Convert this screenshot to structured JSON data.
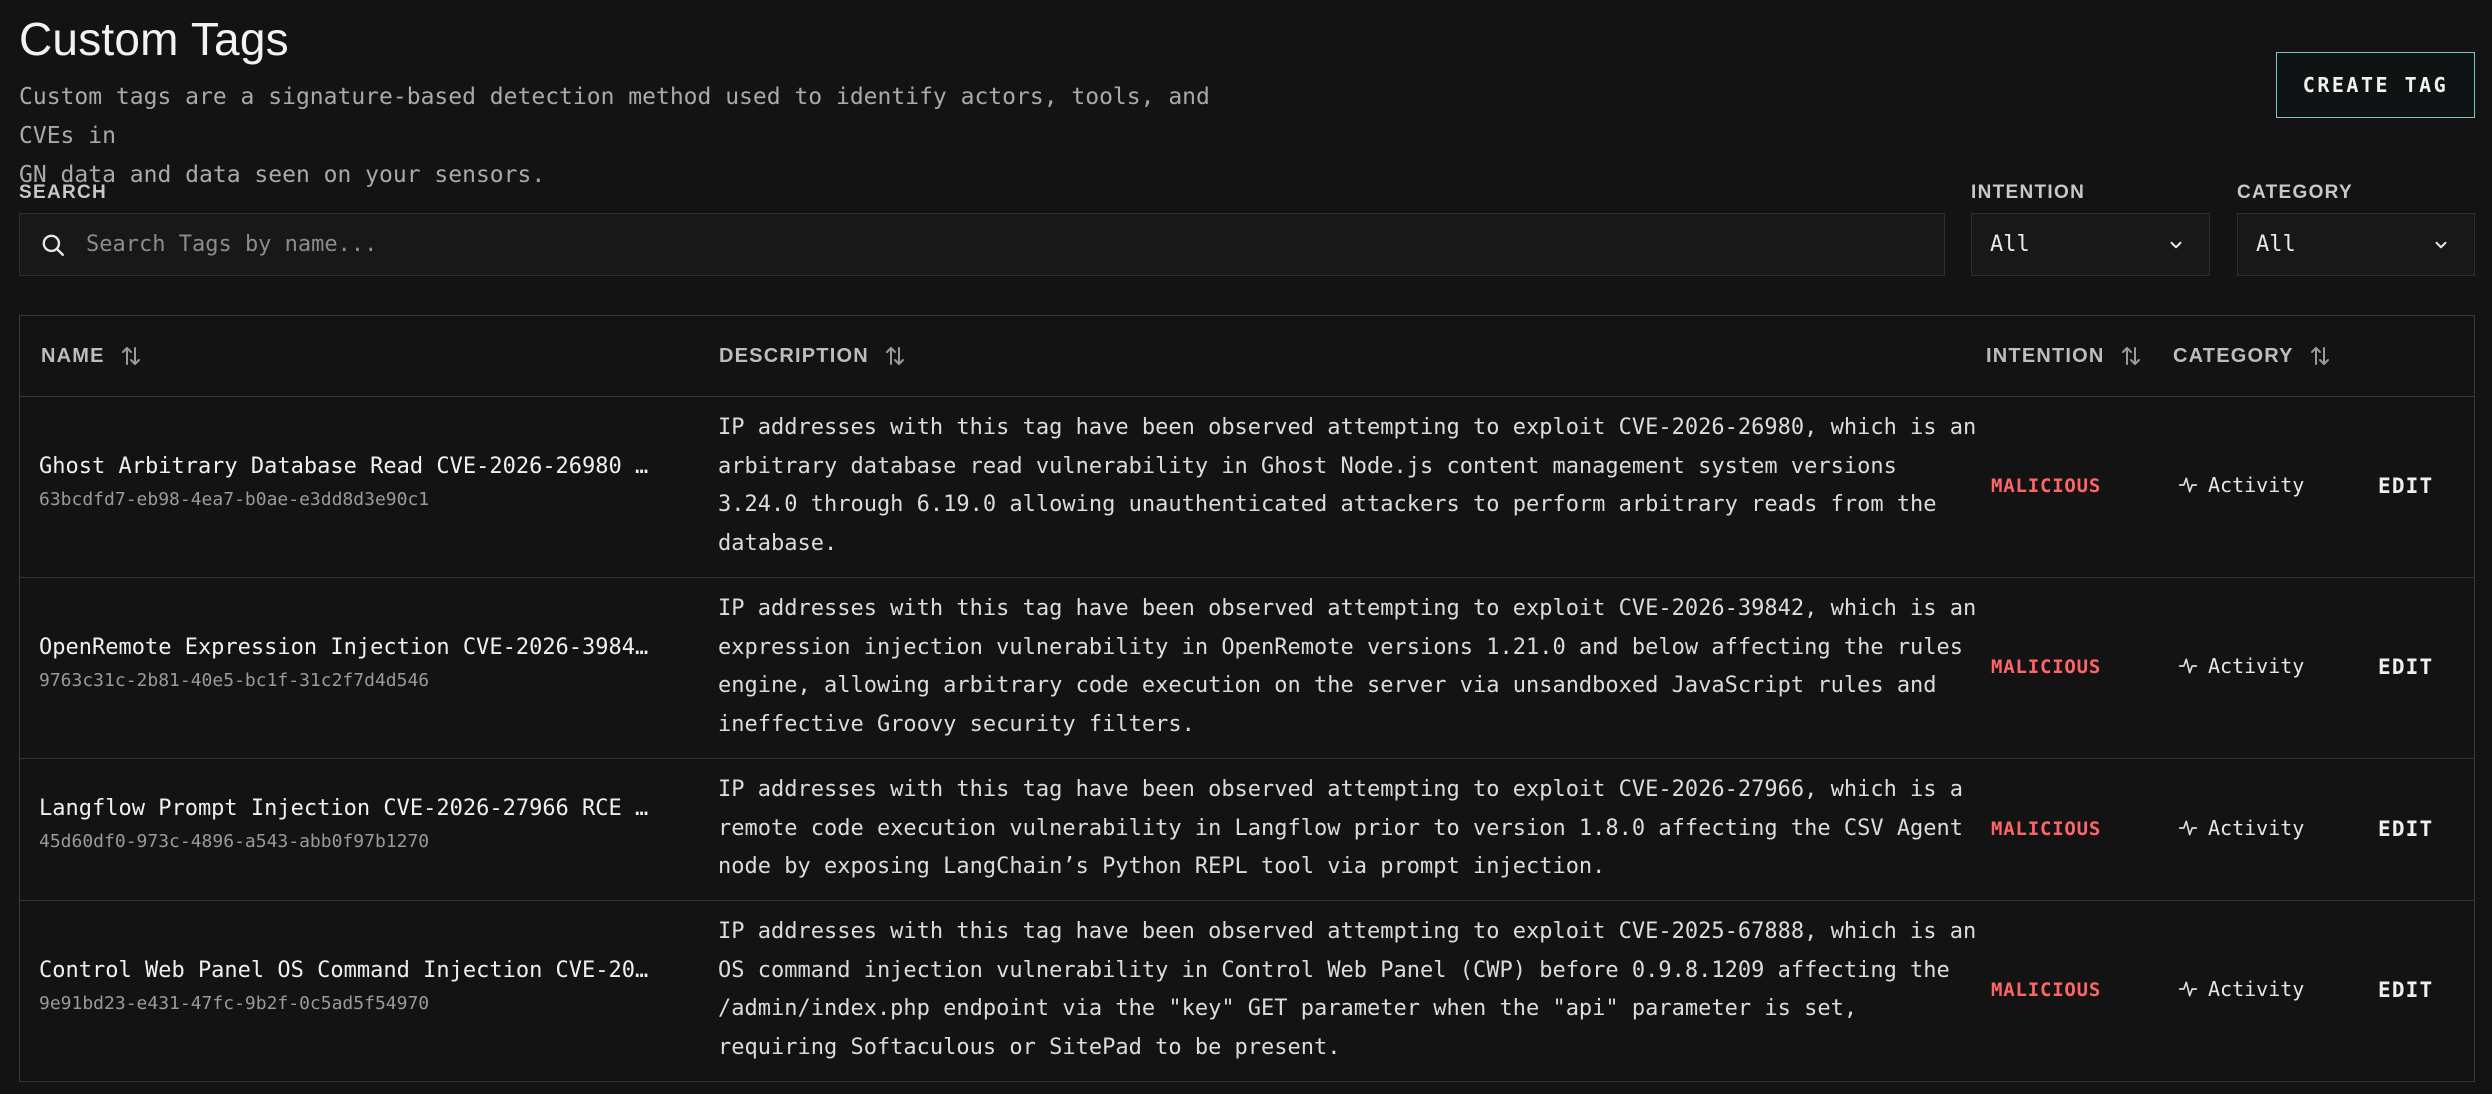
{
  "header": {
    "title": "Custom Tags",
    "subtitle_line1": "Custom tags are a signature-based detection method used to identify actors, tools, and CVEs in",
    "subtitle_line2": "GN data and data seen on your sensors.",
    "create_button": "CREATE TAG"
  },
  "filters": {
    "search_label": "SEARCH",
    "search_placeholder": "Search Tags by name...",
    "intention_label": "INTENTION",
    "intention_value": "All",
    "category_label": "CATEGORY",
    "category_value": "All"
  },
  "table": {
    "columns": {
      "name": "NAME",
      "description": "DESCRIPTION",
      "intention": "INTENTION",
      "category": "CATEGORY"
    },
    "rows": [
      {
        "name": "Ghost Arbitrary Database Read CVE-2026-26980 …",
        "uuid": "63bcdfd7-eb98-4ea7-b0ae-e3dd8d3e90c1",
        "description": [
          "IP addresses with this tag have been observed attempting to exploit CVE-2026-26980, which is an",
          "arbitrary database read vulnerability in Ghost Node.js content management system versions",
          "3.24.0 through 6.19.0 allowing unauthenticated attackers to perform arbitrary reads from the",
          "database."
        ],
        "intention": "MALICIOUS",
        "category": "Activity",
        "action": "EDIT"
      },
      {
        "name": "OpenRemote Expression Injection CVE-2026-3984…",
        "uuid": "9763c31c-2b81-40e5-bc1f-31c2f7d4d546",
        "description": [
          "IP addresses with this tag have been observed attempting to exploit CVE-2026-39842, which is an",
          "expression injection vulnerability in OpenRemote versions 1.21.0 and below affecting the rules",
          "engine, allowing arbitrary code execution on the server via unsandboxed JavaScript rules and",
          "ineffective Groovy security filters."
        ],
        "intention": "MALICIOUS",
        "category": "Activity",
        "action": "EDIT"
      },
      {
        "name": "Langflow Prompt Injection CVE-2026-27966 RCE …",
        "uuid": "45d60df0-973c-4896-a543-abb0f97b1270",
        "description": [
          "IP addresses with this tag have been observed attempting to exploit CVE-2026-27966, which is a",
          "remote code execution vulnerability in Langflow prior to version 1.8.0 affecting the CSV Agent",
          "node by exposing LangChain’s Python REPL tool via prompt injection."
        ],
        "intention": "MALICIOUS",
        "category": "Activity",
        "action": "EDIT"
      },
      {
        "name": "Control Web Panel OS Command Injection CVE-20…",
        "uuid": "9e91bd23-e431-47fc-9b2f-0c5ad5f54970",
        "description": [
          "IP addresses with this tag have been observed attempting to exploit CVE-2025-67888, which is an",
          "OS command injection vulnerability in Control Web Panel (CWP) before 0.9.8.1209 affecting the",
          "/admin/index.php endpoint via the \"key\" GET parameter when the \"api\" parameter is set,",
          "requiring Softaculous or SitePad to be present."
        ],
        "intention": "MALICIOUS",
        "category": "Activity",
        "action": "EDIT"
      }
    ]
  },
  "colors": {
    "background": "#131313",
    "malicious": "#ff6468",
    "button_border": "#7fc4c4"
  }
}
